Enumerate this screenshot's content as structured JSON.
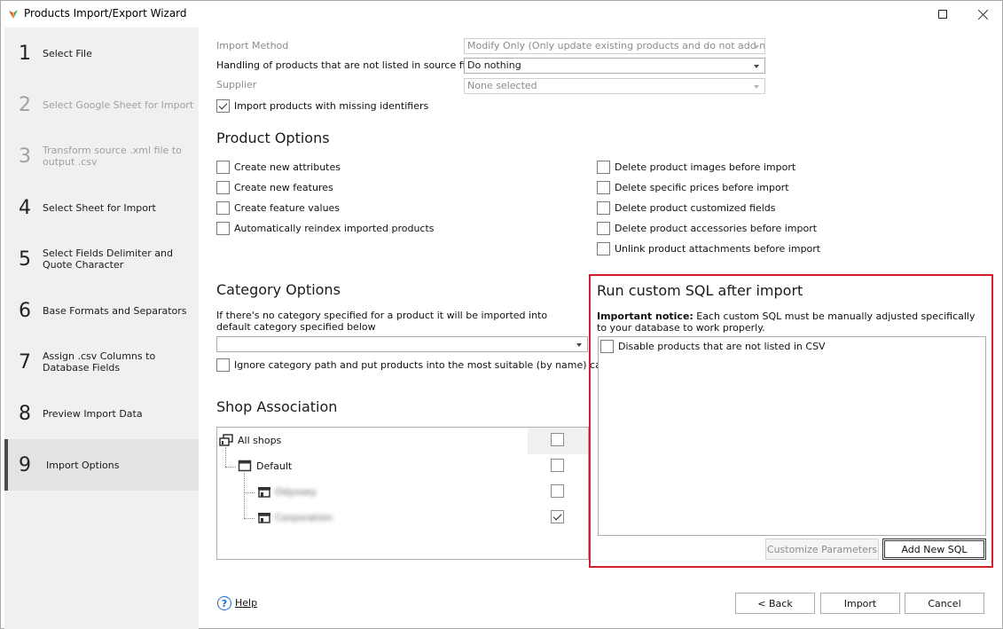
{
  "window": {
    "title": "Products Import/Export Wizard"
  },
  "steps": [
    {
      "num": "1",
      "label": "Select File",
      "state": "normal"
    },
    {
      "num": "2",
      "label": "Select Google Sheet for Import",
      "state": "disabled"
    },
    {
      "num": "3",
      "label": "Transform source .xml file to output .csv",
      "state": "disabled"
    },
    {
      "num": "4",
      "label": "Select Sheet for Import",
      "state": "normal"
    },
    {
      "num": "5",
      "label": "Select Fields Delimiter and Quote Character",
      "state": "normal"
    },
    {
      "num": "6",
      "label": "Base Formats and Separators",
      "state": "normal"
    },
    {
      "num": "7",
      "label": "Assign .csv Columns to Database Fields",
      "state": "normal"
    },
    {
      "num": "8",
      "label": "Preview Import Data",
      "state": "normal"
    },
    {
      "num": "9",
      "label": "Import Options",
      "state": "active"
    }
  ],
  "import": {
    "method_label": "Import Method",
    "method_value": "Modify Only (Only update existing products and do not add new)",
    "handling_label": "Handling of products that are not listed in source file",
    "handling_value": "Do nothing",
    "supplier_label": "Supplier",
    "supplier_value": "None selected",
    "missing_ids_label": "Import products with missing identifiers",
    "missing_ids_checked": true
  },
  "product_options": {
    "title": "Product Options",
    "left": [
      {
        "label": "Create new attributes",
        "checked": false
      },
      {
        "label": "Create new features",
        "checked": false
      },
      {
        "label": "Create feature values",
        "checked": false
      },
      {
        "label": "Automatically reindex imported products",
        "checked": false
      }
    ],
    "right": [
      {
        "label": "Delete product images before import",
        "checked": false
      },
      {
        "label": "Delete specific prices before import",
        "checked": false
      },
      {
        "label": "Delete product customized fields",
        "checked": false
      },
      {
        "label": "Delete product accessories before import",
        "checked": false
      },
      {
        "label": "Unlink product attachments before import",
        "checked": false
      }
    ]
  },
  "category_options": {
    "title": "Category Options",
    "description": "If there's no category specified for a product it will be imported into default category specified below",
    "combo_value": "",
    "ignore_path_label": "Ignore category path and put products into the most suitable (by name) category",
    "ignore_path_checked": false
  },
  "shop_association": {
    "title": "Shop Association",
    "all_shops": {
      "label": "All shops",
      "checked": false
    },
    "group": {
      "label": "Default",
      "checked": false
    },
    "shops": [
      {
        "label": "Odyssey",
        "checked": false
      },
      {
        "label": "Corporation",
        "checked": true
      }
    ]
  },
  "custom_sql": {
    "title": "Run custom SQL after import",
    "notice_bold": "Important notice:",
    "notice_text": " Each custom SQL must be manually adjusted specifically to your database to work properly.",
    "items": [
      {
        "label": "Disable products that are not listed in CSV",
        "checked": false
      }
    ],
    "customize_button": "Customize Parameters",
    "add_button": "Add New SQL"
  },
  "footer": {
    "help_label": "Help",
    "back_label": "< Back",
    "import_label": "Import",
    "cancel_label": "Cancel"
  },
  "colors": {
    "highlight_border": "#d0202a",
    "help_accent": "#1f6fc5"
  }
}
